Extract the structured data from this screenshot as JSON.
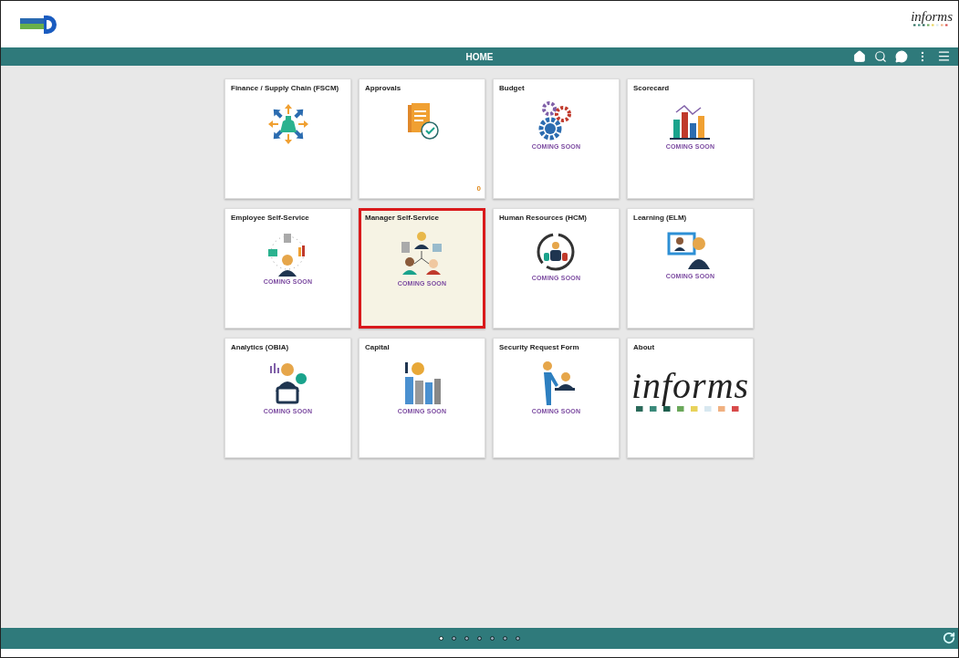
{
  "header": {
    "brand": "informs"
  },
  "nav_bar": {
    "title": "HOME"
  },
  "tiles": [
    {
      "title": "Finance / Supply Chain (FSCM)",
      "selected": false
    },
    {
      "title": "Approvals",
      "count": "0",
      "selected": false
    },
    {
      "title": "Budget",
      "note": "COMING SOON",
      "selected": false
    },
    {
      "title": "Scorecard",
      "note": "COMING SOON",
      "selected": false
    },
    {
      "title": "Employee Self-Service",
      "note": "COMING SOON",
      "selected": false
    },
    {
      "title": "Manager Self-Service",
      "note": "COMING SOON",
      "selected": true
    },
    {
      "title": "Human Resources (HCM)",
      "note": "COMING SOON",
      "selected": false
    },
    {
      "title": "Learning (ELM)",
      "note": "COMING SOON",
      "selected": false
    },
    {
      "title": "Analytics (OBIA)",
      "note": "COMING SOON",
      "selected": false
    },
    {
      "title": "Capital",
      "note": "COMING SOON",
      "selected": false
    },
    {
      "title": "Security Request Form",
      "note": "COMING SOON",
      "selected": false
    },
    {
      "title": "About",
      "logo": "informs",
      "selected": false
    }
  ],
  "pages": [
    {
      "selected": true
    },
    {
      "selected": false
    },
    {
      "selected": false
    },
    {
      "selected": false
    },
    {
      "selected": false
    },
    {
      "selected": false
    },
    {
      "selected": false
    }
  ]
}
